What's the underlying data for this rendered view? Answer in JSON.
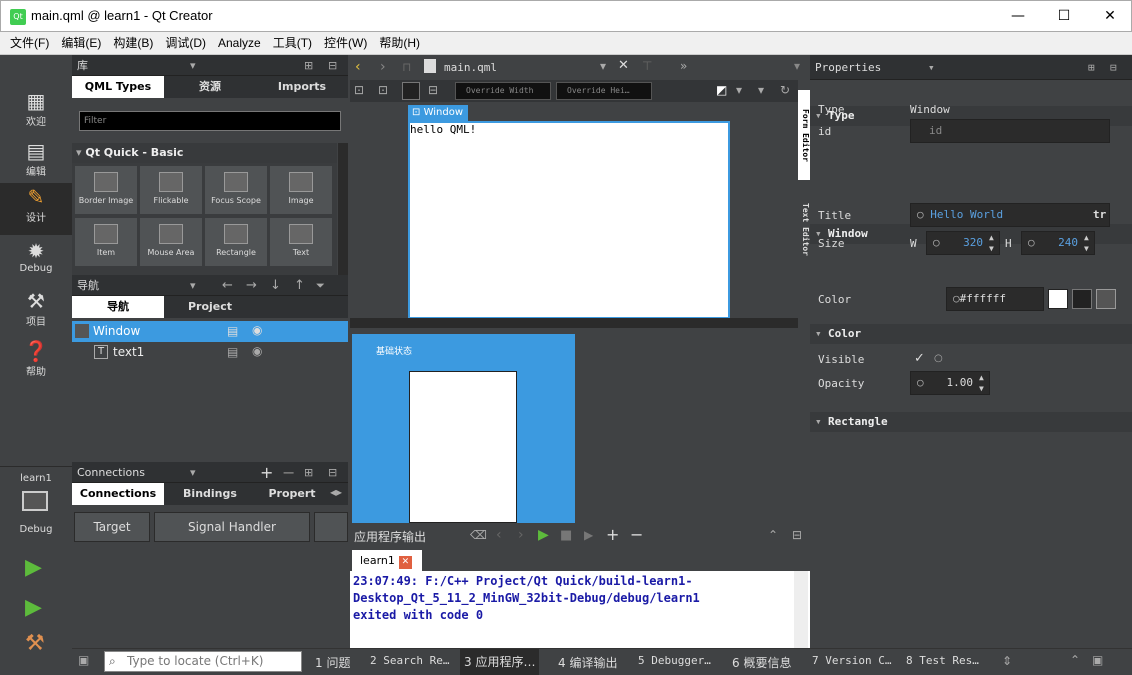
{
  "window": {
    "title": "main.qml @ learn1 - Qt Creator",
    "logo": "Qt",
    "minimize": "—",
    "maximize": "☐",
    "close": "✕"
  },
  "menu": [
    "文件(F)",
    "编辑(E)",
    "构建(B)",
    "调试(D)",
    "Analyze",
    "工具(T)",
    "控件(W)",
    "帮助(H)"
  ],
  "modes": [
    {
      "label": "欢迎",
      "icon": "grid-icon"
    },
    {
      "label": "编辑",
      "icon": "document-icon"
    },
    {
      "label": "设计",
      "icon": "pencil-icon"
    },
    {
      "label": "Debug",
      "icon": "bug-icon"
    },
    {
      "label": "项目",
      "icon": "wrench-icon"
    },
    {
      "label": "帮助",
      "icon": "help-icon"
    }
  ],
  "kit": {
    "project": "learn1",
    "config": "Debug"
  },
  "library": {
    "header": "库",
    "tabs": [
      "QML Types",
      "资源",
      "Imports"
    ],
    "filter_placeholder": "Filter",
    "section": "Qt Quick - Basic",
    "items": [
      "Border Image",
      "Flickable",
      "Focus Scope",
      "Image",
      "Item",
      "Mouse Area",
      "Rectangle",
      "Text"
    ]
  },
  "navigator": {
    "header": "导航",
    "tabs": [
      "导航",
      "Project"
    ],
    "nodes": [
      {
        "label": "Window"
      },
      {
        "label": "text1"
      }
    ]
  },
  "connections": {
    "header": "Connections",
    "tabs": [
      "Connections",
      "Bindings",
      "Propert"
    ],
    "columns": [
      "Target",
      "Signal Handler"
    ]
  },
  "editor": {
    "file": "main.qml",
    "override_width": "Override Width",
    "override_height": "Override Hei…",
    "window_tag": "Window",
    "canvas_text": "hello QML!",
    "side_tabs": [
      "Form Editor",
      "Text Editor"
    ],
    "state_label": "基础状态"
  },
  "output": {
    "header": "应用程序输出",
    "tab": "learn1",
    "lines": [
      "23:07:49: F:/C++ Project/Qt Quick/build-learn1-",
      "Desktop_Qt_5_11_2_MinGW_32bit-Debug/debug/learn1",
      "exited with code 0"
    ]
  },
  "properties": {
    "header": "Properties",
    "type_section": "Type",
    "type_label": "Type",
    "type_value": "Window",
    "id_label": "id",
    "id_placeholder": "id",
    "window_section": "Window",
    "title_label": "Title",
    "title_value": "Hello World",
    "tr": "tr",
    "size_label": "Size",
    "w_label": "W",
    "w_value": "320",
    "h_label": "H",
    "h_value": "240",
    "color_section": "Color",
    "color_label": "Color",
    "color_value": "#ffffff",
    "rect_section": "Rectangle",
    "visible_label": "Visible",
    "opacity_label": "Opacity",
    "opacity_value": "1.00"
  },
  "statusbar": {
    "locate_placeholder": "Type to locate (Ctrl+K)",
    "panes": [
      "1 问题",
      "2 Search Re…",
      "3 应用程序…",
      "4 编译输出",
      "5 Debugger…",
      "6 概要信息",
      "7 Version C…",
      "8 Test Res…"
    ]
  },
  "colors": {
    "accent": "#3c9ae0",
    "background": "#404244",
    "selection": "#3c9ae0",
    "output_text": "#1a1aa6"
  }
}
